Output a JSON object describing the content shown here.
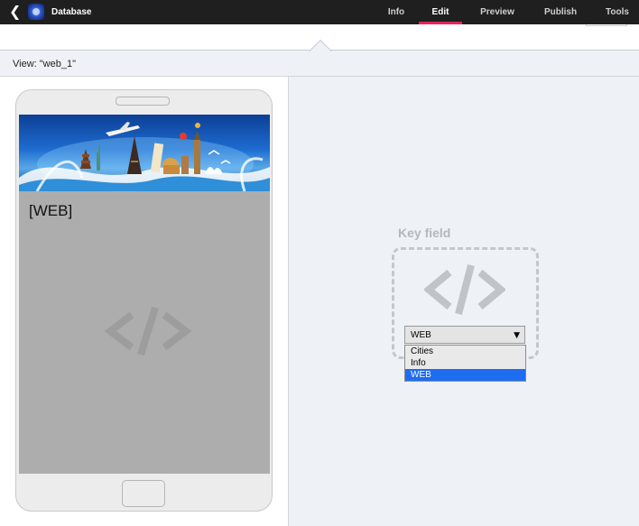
{
  "topbar": {
    "title": "Database",
    "tabs": [
      {
        "label": "Info"
      },
      {
        "label": "Edit"
      },
      {
        "label": "Preview"
      },
      {
        "label": "Publish"
      },
      {
        "label": "Tools"
      }
    ],
    "active_tab": "Edit",
    "accent_color": "#e0275a"
  },
  "view": {
    "label": "View: \"web_1\""
  },
  "preview": {
    "field_value": "[WEB]"
  },
  "key_field": {
    "title": "Key field",
    "selected": "WEB",
    "options": [
      "Cities",
      "Info",
      "WEB"
    ],
    "highlight_color": "#1e6cf0"
  }
}
